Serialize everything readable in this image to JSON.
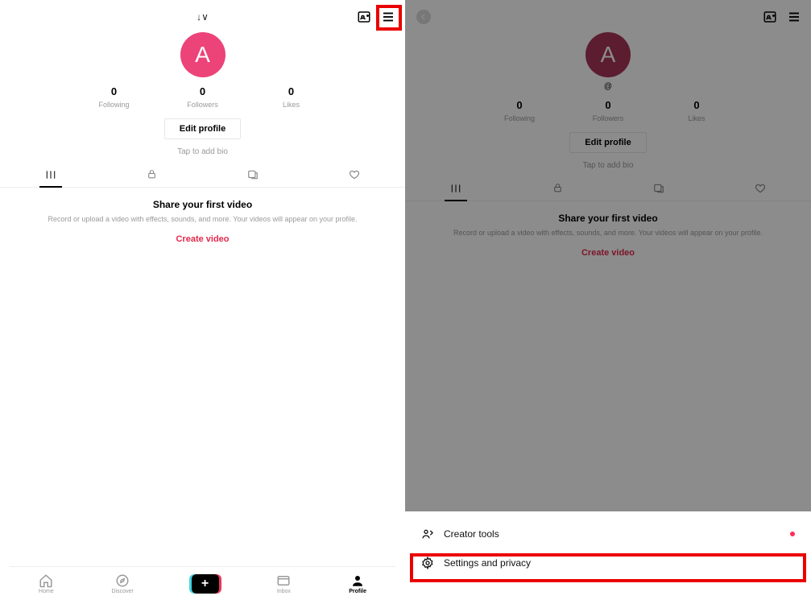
{
  "left": {
    "avatar_letter": "A",
    "username_prefix": "↓∨",
    "stats": {
      "following": "0",
      "following_label": "Following",
      "followers": "0",
      "followers_label": "Followers",
      "likes": "0",
      "likes_label": "Likes"
    },
    "edit_profile": "Edit profile",
    "bio": "Tap to add bio",
    "empty": {
      "title": "Share your first video",
      "desc": "Record or upload a video with effects, sounds, and more. Your videos will appear on your profile.",
      "cta": "Create video"
    },
    "nav": {
      "home": "Home",
      "discover": "Discover",
      "inbox": "Inbox",
      "profile": "Profile"
    }
  },
  "right": {
    "avatar_letter": "A",
    "at_symbol": "@",
    "stats": {
      "following": "0",
      "following_label": "Following",
      "followers": "0",
      "followers_label": "Followers",
      "likes": "0",
      "likes_label": "Likes"
    },
    "edit_profile": "Edit profile",
    "bio": "Tap to add bio",
    "empty": {
      "title": "Share your first video",
      "desc": "Record or upload a video with effects, sounds, and more. Your videos will appear on your profile.",
      "cta": "Create video"
    },
    "sheet": {
      "creator_tools": "Creator tools",
      "settings": "Settings and privacy"
    }
  }
}
